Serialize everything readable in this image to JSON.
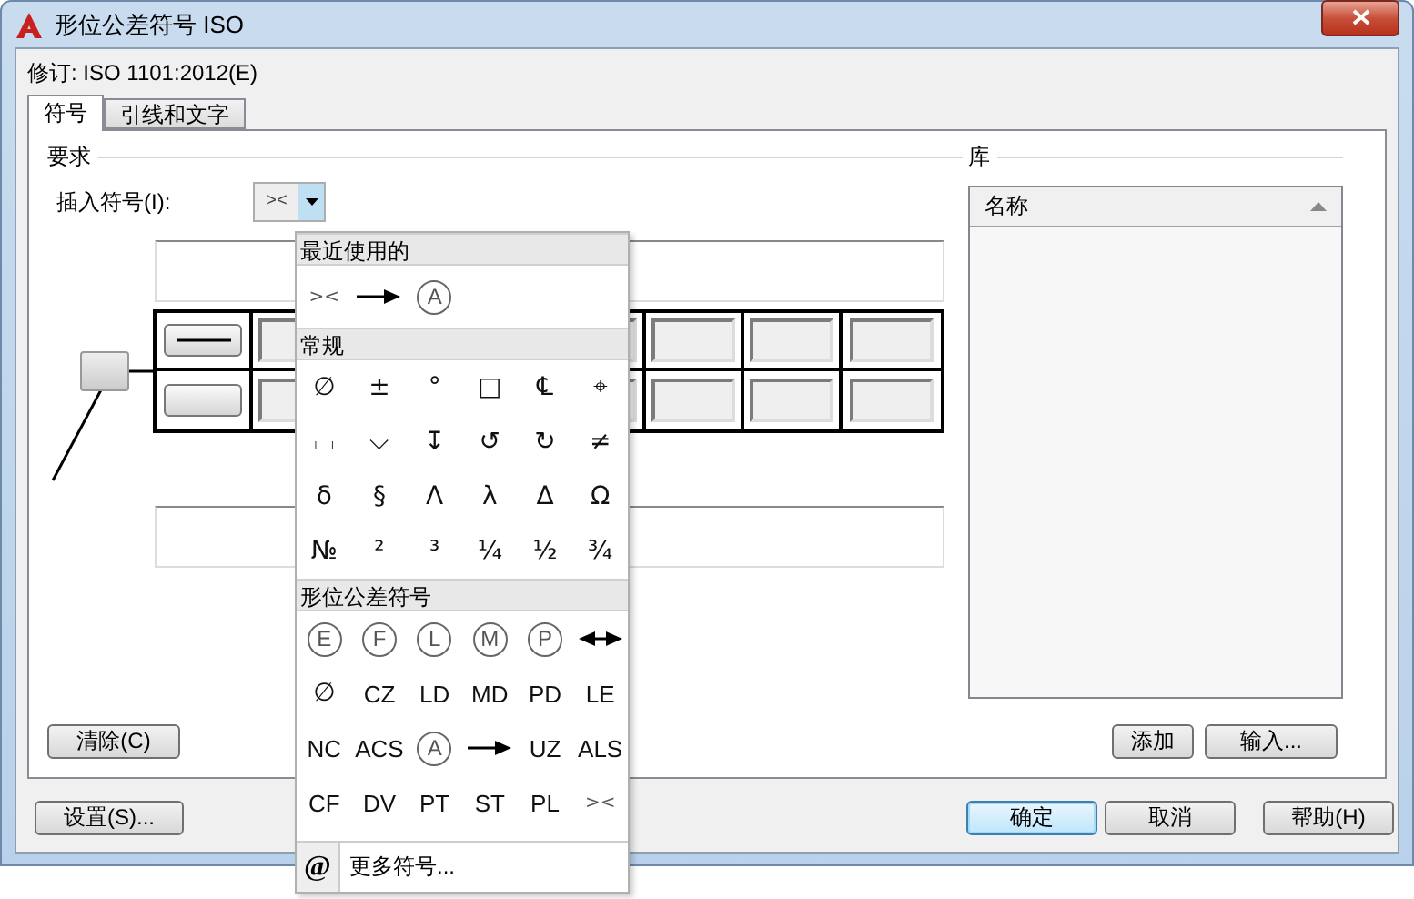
{
  "window": {
    "title": "形位公差符号 ISO"
  },
  "revision": "修订: ISO 1101:2012(E)",
  "tabs": [
    {
      "label": "符号",
      "selected": true
    },
    {
      "label": "引线和文字",
      "selected": false
    }
  ],
  "requirements": {
    "title": "要求",
    "insert_label": "插入符号(I):",
    "insert_value": "><",
    "clear_button": "清除(C)"
  },
  "library": {
    "title": "库",
    "column": "名称",
    "buttons": [
      "添加",
      "输入..."
    ]
  },
  "symbol_menu": {
    "sections": [
      {
        "title": "最近使用的",
        "items": [
          {
            "kind": "small",
            "text": "><"
          },
          {
            "kind": "arrow"
          },
          {
            "kind": "circled",
            "text": "A"
          }
        ]
      },
      {
        "title": "常规",
        "items": [
          {
            "kind": "text",
            "text": "∅"
          },
          {
            "kind": "text",
            "text": "±"
          },
          {
            "kind": "text",
            "text": "°"
          },
          {
            "kind": "text",
            "text": "□"
          },
          {
            "kind": "text",
            "text": "℄"
          },
          {
            "kind": "text",
            "text": "⌖"
          },
          {
            "kind": "text",
            "text": "⌴"
          },
          {
            "kind": "text",
            "text": "⌵"
          },
          {
            "kind": "text",
            "text": "↧"
          },
          {
            "kind": "text",
            "text": "↺"
          },
          {
            "kind": "text",
            "text": "↻"
          },
          {
            "kind": "text",
            "text": "≠"
          },
          {
            "kind": "text",
            "text": "δ"
          },
          {
            "kind": "text",
            "text": "§"
          },
          {
            "kind": "text",
            "text": "Λ"
          },
          {
            "kind": "text",
            "text": "λ"
          },
          {
            "kind": "text",
            "text": "Δ"
          },
          {
            "kind": "text",
            "text": "Ω"
          },
          {
            "kind": "text",
            "text": "№"
          },
          {
            "kind": "text",
            "text": "²"
          },
          {
            "kind": "text",
            "text": "³"
          },
          {
            "kind": "text",
            "text": "¼"
          },
          {
            "kind": "text",
            "text": "½"
          },
          {
            "kind": "text",
            "text": "¾"
          }
        ]
      },
      {
        "title": "形位公差符号",
        "items": [
          {
            "kind": "circled",
            "text": "E"
          },
          {
            "kind": "circled",
            "text": "F"
          },
          {
            "kind": "circled",
            "text": "L"
          },
          {
            "kind": "circled",
            "text": "M"
          },
          {
            "kind": "circled",
            "text": "P"
          },
          {
            "kind": "double-arrow"
          },
          {
            "kind": "text",
            "text": "∅"
          },
          {
            "kind": "text",
            "text": "CZ"
          },
          {
            "kind": "text",
            "text": "LD"
          },
          {
            "kind": "text",
            "text": "MD"
          },
          {
            "kind": "text",
            "text": "PD"
          },
          {
            "kind": "text",
            "text": "LE"
          },
          {
            "kind": "text",
            "text": "NC"
          },
          {
            "kind": "text",
            "text": "ACS"
          },
          {
            "kind": "circled",
            "text": "A"
          },
          {
            "kind": "arrow"
          },
          {
            "kind": "text",
            "text": "UZ"
          },
          {
            "kind": "text",
            "text": "ALS"
          },
          {
            "kind": "text",
            "text": "CF"
          },
          {
            "kind": "text",
            "text": "DV"
          },
          {
            "kind": "text",
            "text": "PT"
          },
          {
            "kind": "text",
            "text": "ST"
          },
          {
            "kind": "text",
            "text": "PL"
          },
          {
            "kind": "small",
            "text": "><"
          }
        ]
      }
    ],
    "more": {
      "icon": "@",
      "label": "更多符号..."
    }
  },
  "buttons": [
    {
      "label": "设置(S)...",
      "default": false
    },
    {
      "label": "确定",
      "default": true
    },
    {
      "label": "取消",
      "default": false
    },
    {
      "label": "帮助(H)",
      "default": false
    }
  ]
}
